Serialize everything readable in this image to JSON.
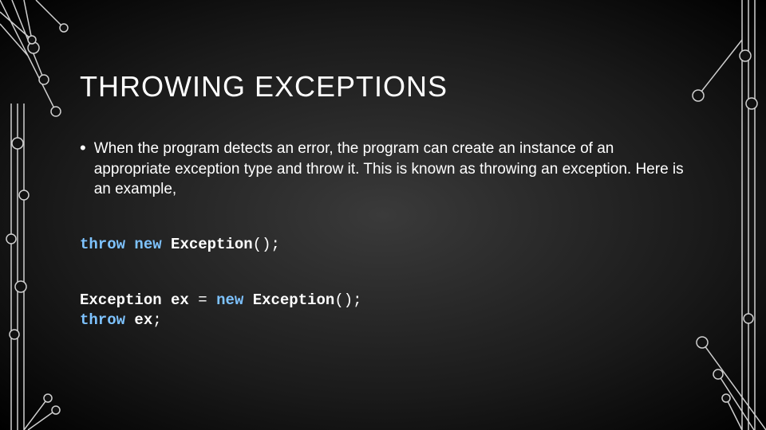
{
  "title": "THROWING EXCEPTIONS",
  "bullet": "When the program detects an error, the program can create an instance of an appropriate exception type and throw it. This is known as throwing an exception. Here is an example,",
  "code1": {
    "kw_throw": "throw",
    "kw_new": "new",
    "cls": "Exception",
    "tail": "();"
  },
  "code2": {
    "line1": {
      "cls1": "Exception",
      "var": "ex",
      "eq": "=",
      "kw_new": "new",
      "cls2": "Exception",
      "tail": "();"
    },
    "line2": {
      "kw_throw": "throw",
      "var": "ex",
      "semi": ";"
    }
  }
}
